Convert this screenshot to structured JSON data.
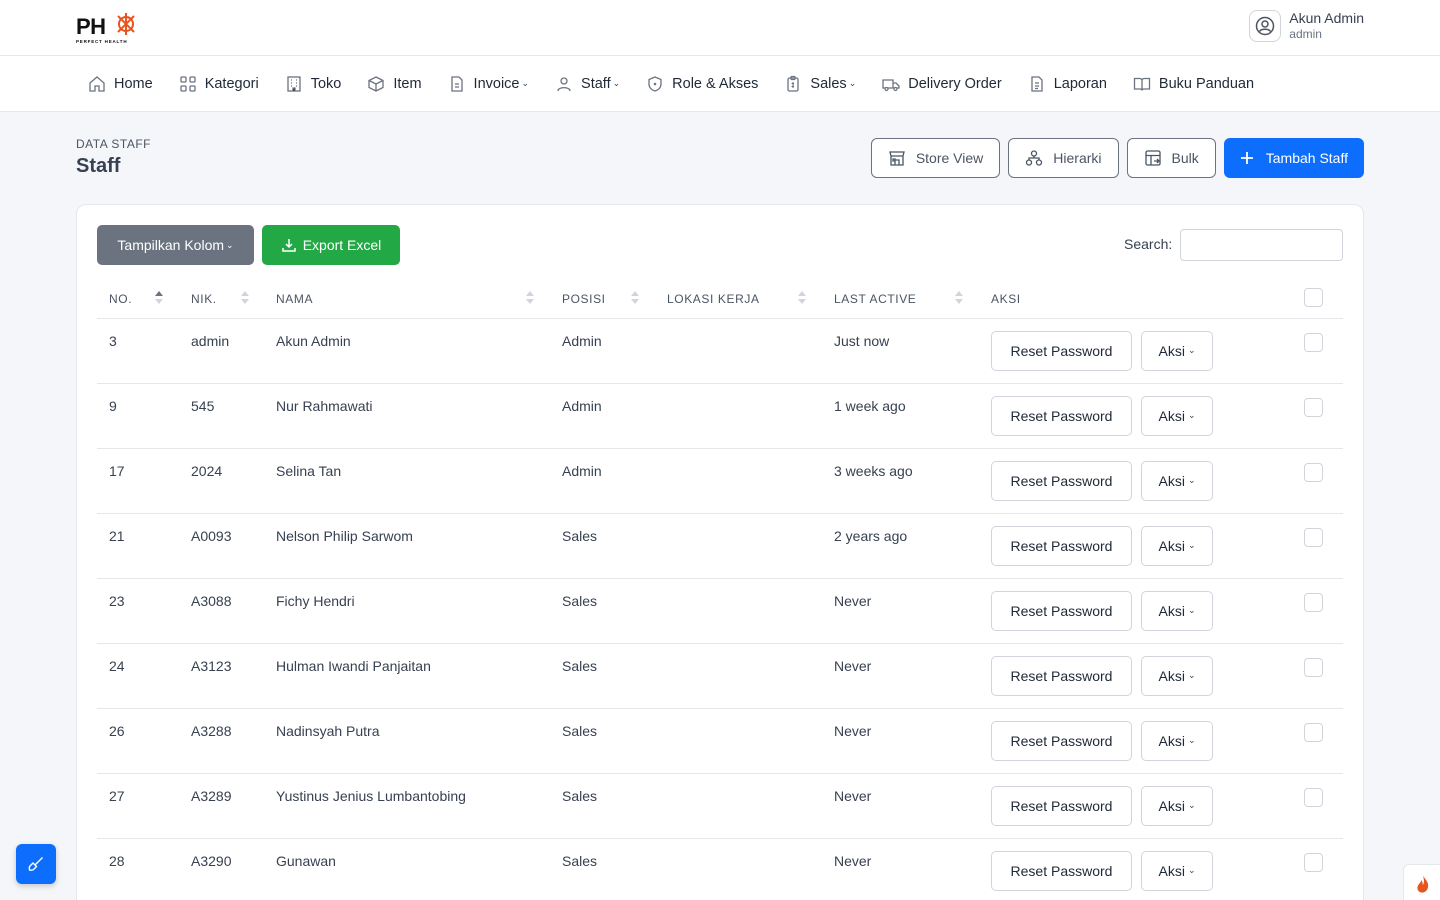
{
  "brand": {
    "logo_text": "PH",
    "logo_tagline": "PERFECT HEALTH"
  },
  "user": {
    "name": "Akun Admin",
    "role": "admin"
  },
  "nav": [
    {
      "label": "Home",
      "icon": "home-icon",
      "dropdown": false
    },
    {
      "label": "Kategori",
      "icon": "grid-icon",
      "dropdown": false
    },
    {
      "label": "Toko",
      "icon": "building-icon",
      "dropdown": false
    },
    {
      "label": "Item",
      "icon": "box-icon",
      "dropdown": false
    },
    {
      "label": "Invoice",
      "icon": "document-icon",
      "dropdown": true
    },
    {
      "label": "Staff",
      "icon": "user-icon",
      "dropdown": true
    },
    {
      "label": "Role & Akses",
      "icon": "shield-icon",
      "dropdown": false
    },
    {
      "label": "Sales",
      "icon": "clipboard-icon",
      "dropdown": true
    },
    {
      "label": "Delivery Order",
      "icon": "truck-icon",
      "dropdown": false
    },
    {
      "label": "Laporan",
      "icon": "report-icon",
      "dropdown": false
    },
    {
      "label": "Buku Panduan",
      "icon": "book-icon",
      "dropdown": false
    }
  ],
  "page": {
    "eyebrow": "DATA STAFF",
    "title": "Staff",
    "actions": {
      "store_view": "Store View",
      "hierarki": "Hierarki",
      "bulk": "Bulk",
      "tambah": "Tambah Staff"
    }
  },
  "toolbar": {
    "columns": "Tampilkan Kolom",
    "export": "Export Excel",
    "search_label": "Search:",
    "search_value": ""
  },
  "table": {
    "headers": [
      "NO.",
      "NIK.",
      "NAMA",
      "POSISI",
      "LOKASI KERJA",
      "LAST ACTIVE",
      "AKSI"
    ],
    "reset_label": "Reset Password",
    "aksi_label": "Aksi",
    "rows": [
      {
        "no": "3",
        "nik": "admin",
        "nama": "Akun Admin",
        "posisi": "Admin",
        "lokasi": "",
        "last": "Just now"
      },
      {
        "no": "9",
        "nik": "545",
        "nama": "Nur Rahmawati",
        "posisi": "Admin",
        "lokasi": "",
        "last": "1 week ago"
      },
      {
        "no": "17",
        "nik": "2024",
        "nama": "Selina Tan",
        "posisi": "Admin",
        "lokasi": "",
        "last": "3 weeks ago"
      },
      {
        "no": "21",
        "nik": "A0093",
        "nama": "Nelson Philip Sarwom",
        "posisi": "Sales",
        "lokasi": "",
        "last": "2 years ago"
      },
      {
        "no": "23",
        "nik": "A3088",
        "nama": "Fichy Hendri",
        "posisi": "Sales",
        "lokasi": "",
        "last": "Never"
      },
      {
        "no": "24",
        "nik": "A3123",
        "nama": "Hulman Iwandi Panjaitan",
        "posisi": "Sales",
        "lokasi": "",
        "last": "Never"
      },
      {
        "no": "26",
        "nik": "A3288",
        "nama": "Nadinsyah Putra",
        "posisi": "Sales",
        "lokasi": "",
        "last": "Never"
      },
      {
        "no": "27",
        "nik": "A3289",
        "nama": "Yustinus Jenius Lumbantobing",
        "posisi": "Sales",
        "lokasi": "",
        "last": "Never"
      },
      {
        "no": "28",
        "nik": "A3290",
        "nama": "Gunawan",
        "posisi": "Sales",
        "lokasi": "",
        "last": "Never"
      }
    ]
  },
  "colors": {
    "primary": "#0d6efd",
    "success": "#22a845",
    "secondary": "#6b7280",
    "brand_accent": "#e8531e"
  }
}
